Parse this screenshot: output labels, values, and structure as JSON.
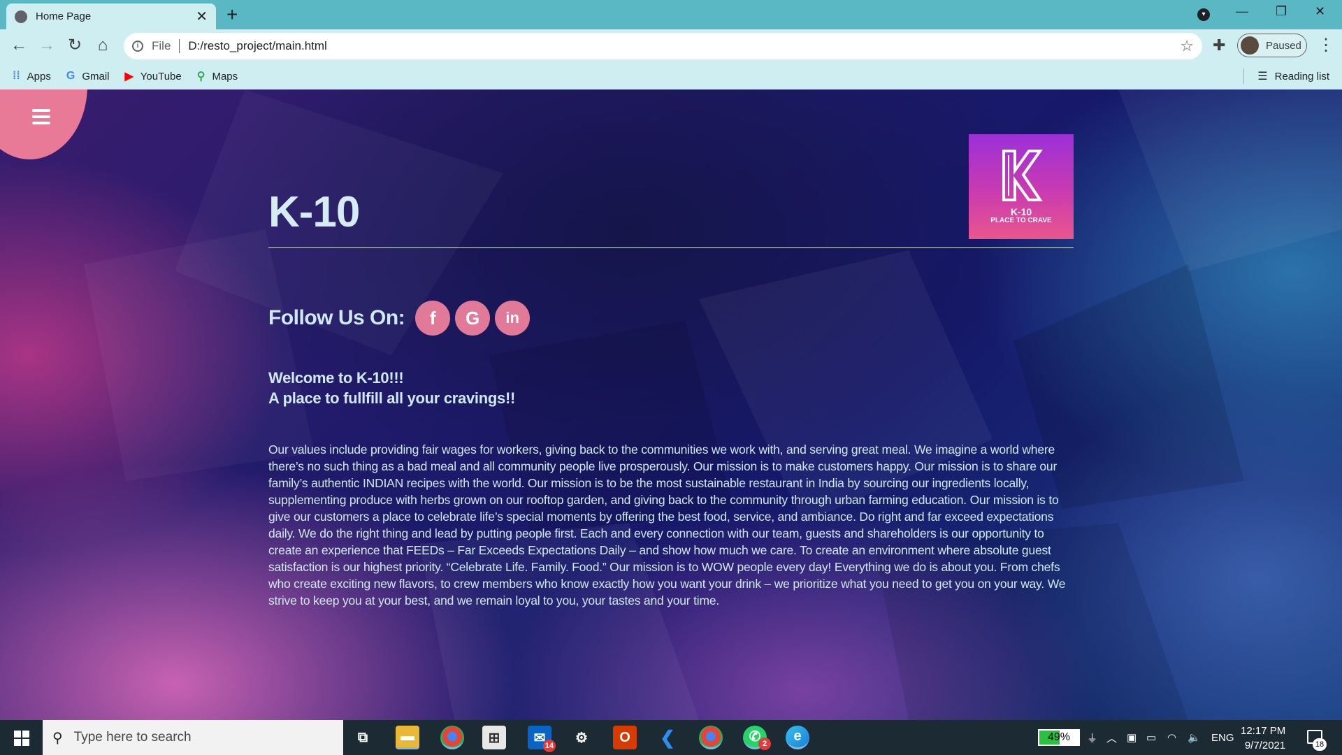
{
  "browser": {
    "tab_title": "Home Page",
    "tab_close": "✕",
    "new_tab": "+",
    "url_scheme": "File",
    "url": "D:/resto_project/main.html",
    "profile_status": "Paused",
    "bookmarks": [
      {
        "label": "Apps",
        "icon": "apps-grid-icon"
      },
      {
        "label": "Gmail",
        "icon": "google-icon"
      },
      {
        "label": "YouTube",
        "icon": "youtube-icon"
      },
      {
        "label": "Maps",
        "icon": "maps-pin-icon"
      }
    ],
    "reading_list": "Reading list"
  },
  "page": {
    "brand": "K-10",
    "logo_name": "K-10",
    "logo_tagline": "PLACE TO CRAVE",
    "follow_label": "Follow Us On:",
    "social": [
      {
        "label": "f",
        "icon": "facebook-icon"
      },
      {
        "label": "G",
        "icon": "google-icon"
      },
      {
        "label": "in",
        "icon": "linkedin-icon"
      }
    ],
    "welcome_line1": "Welcome to K-10!!!",
    "welcome_line2": "A place to fullfill all your cravings!!",
    "about": "Our values include providing fair wages for workers, giving back to the communities we work with, and serving great meal. We imagine a world where there’s no such thing as a bad meal and all community people live prosperously. Our mission is to make customers happy. Our mission is to share our family’s authentic INDIAN recipes with the world. Our mission is to be the most sustainable restaurant in India by sourcing our ingredients locally, supplementing produce with herbs grown on our rooftop garden, and giving back to the community through urban farming education. Our mission is to give our customers a place to celebrate life’s special moments by offering the best food, service, and ambiance. Do right and far exceed expectations daily. We do the right thing and lead by putting people first. Each and every connection with our team, guests and shareholders is our opportunity to create an experience that FEEDs – Far Exceeds Expectations Daily – and show how much we care. To create an environment where absolute guest satisfaction is our highest priority. “Celebrate Life. Family. Food.” Our mission is to WOW people every day! Everything we do is about you. From chefs who create exciting new flavors, to crew members who know exactly how you want your drink – we prioritize what you need to get you on your way. We strive to keep you at your best, and we remain loyal to you, your tastes and your time."
  },
  "taskbar": {
    "search_placeholder": "Type here to search",
    "mail_badge": "14",
    "whatsapp_badge": "2",
    "battery": "49%",
    "language": "ENG",
    "time": "12:17 PM",
    "date": "9/7/2021",
    "notifications": "18"
  },
  "colors": {
    "titlebar": "#5ab8c4",
    "toolbar": "#cfeef1",
    "menu_blob": "#e87a97",
    "social_button": "#e07a98",
    "text_light": "#cfe9f2"
  }
}
